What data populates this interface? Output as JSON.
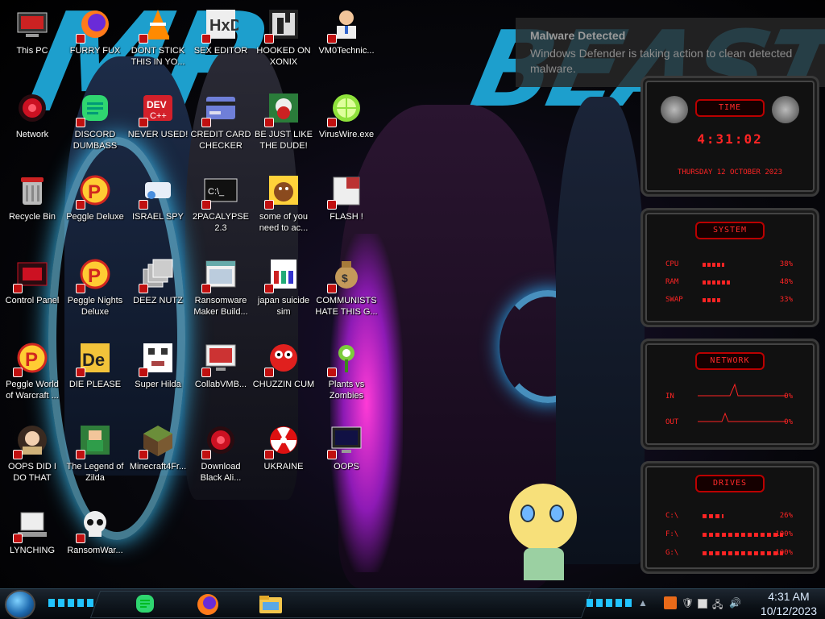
{
  "desktop": {
    "icons": [
      {
        "label": "This PC",
        "icon": "computer-icon"
      },
      {
        "label": "FURRY FUX",
        "icon": "firefox-icon"
      },
      {
        "label": "DONT STICK THIS IN YO...",
        "icon": "vlc-icon"
      },
      {
        "label": "SEX EDITOR",
        "icon": "hxd-icon"
      },
      {
        "label": "HOOKED ON XONIX",
        "icon": "xonix-icon"
      },
      {
        "label": "VM0Technic...",
        "icon": "doctor-icon"
      },
      {
        "label": "Network",
        "icon": "network-icon"
      },
      {
        "label": "DISCORD DUMBASS",
        "icon": "discord-icon"
      },
      {
        "label": "NEVER USED!",
        "icon": "devcpp-icon"
      },
      {
        "label": "CREDIT CARD CHECKER",
        "icon": "credit-card-icon"
      },
      {
        "label": "BE JUST LIKE THE DUDE!",
        "icon": "dude-icon"
      },
      {
        "label": "VirusWire.exe",
        "icon": "lime-icon"
      },
      {
        "label": "Recycle Bin",
        "icon": "recycle-bin-icon"
      },
      {
        "label": "Peggle Deluxe",
        "icon": "peggle-icon"
      },
      {
        "label": "ISRAEL SPY",
        "icon": "spy-icon"
      },
      {
        "label": "2PACALYPSE 2.3",
        "icon": "terminal-icon"
      },
      {
        "label": "some of you need to ac...",
        "icon": "beaver-icon"
      },
      {
        "label": "FLASH !",
        "icon": "flash-icon"
      },
      {
        "label": "Control Panel",
        "icon": "control-panel-icon"
      },
      {
        "label": "Peggle Nights Deluxe",
        "icon": "peggle-icon"
      },
      {
        "label": "DEEZ NUTZ",
        "icon": "windows-stack-icon"
      },
      {
        "label": "Ransomware Maker Build...",
        "icon": "window-icon"
      },
      {
        "label": "japan suicide sim",
        "icon": "installer-icon"
      },
      {
        "label": "COMMUNISTS HATE THIS G...",
        "icon": "money-bag-icon"
      },
      {
        "label": "Peggle World of Warcraft ...",
        "icon": "peggle-icon"
      },
      {
        "label": "DIE PLEASE",
        "icon": "de-icon"
      },
      {
        "label": "Super Hilda",
        "icon": "pixel-icon"
      },
      {
        "label": "CollabVMB...",
        "icon": "monitor-icon"
      },
      {
        "label": "CHUZZIN CUM",
        "icon": "chuzzle-icon"
      },
      {
        "label": "Plants vs Zombies",
        "icon": "plant-icon"
      },
      {
        "label": "OOPS DID I DO THAT",
        "icon": "portrait-icon"
      },
      {
        "label": "The Legend of Zilda",
        "icon": "zelda-icon"
      },
      {
        "label": "Minecraft4Fr...",
        "icon": "minecraft-icon"
      },
      {
        "label": "Download Black Ali...",
        "icon": "alienware-icon"
      },
      {
        "label": "UKRAINE",
        "icon": "radiation-icon"
      },
      {
        "label": "OOPS",
        "icon": "monitor-dark-icon"
      },
      {
        "label": "LYNCHING",
        "icon": "network-drive-icon"
      },
      {
        "label": "RansomWar...",
        "icon": "skull-icon"
      }
    ]
  },
  "notification": {
    "title": "Malware Detected",
    "message": "Windows Defender is taking action to clean detected malware."
  },
  "gadgets": {
    "time": {
      "title": "TIME",
      "clock": "4:31:02",
      "date": "THURSDAY 12 OCTOBER 2023"
    },
    "system": {
      "title": "SYSTEM",
      "rows": [
        {
          "label": "CPU",
          "value": "38%",
          "level": 0.38
        },
        {
          "label": "RAM",
          "value": "48%",
          "level": 0.48
        },
        {
          "label": "SWAP",
          "value": "33%",
          "level": 0.33
        }
      ]
    },
    "network": {
      "title": "NETWORK",
      "rows": [
        {
          "label": "IN",
          "value": "0%"
        },
        {
          "label": "OUT",
          "value": "0%"
        }
      ]
    },
    "drives": {
      "title": "DRIVES",
      "rows": [
        {
          "label": "C:\\",
          "value": "26%"
        },
        {
          "label": "F:\\",
          "value": "100%"
        },
        {
          "label": "G:\\",
          "value": "100%"
        }
      ]
    }
  },
  "taskbar": {
    "clock_time": "4:31 AM",
    "clock_date": "10/12/2023",
    "pinned": [
      "discord-icon",
      "firefox-icon",
      "file-explorer-icon"
    ]
  },
  "colors": {
    "accent_red": "#ff2424",
    "wallpaper_cyan": "#1fa8d8",
    "gadget_dark": "#111111"
  }
}
